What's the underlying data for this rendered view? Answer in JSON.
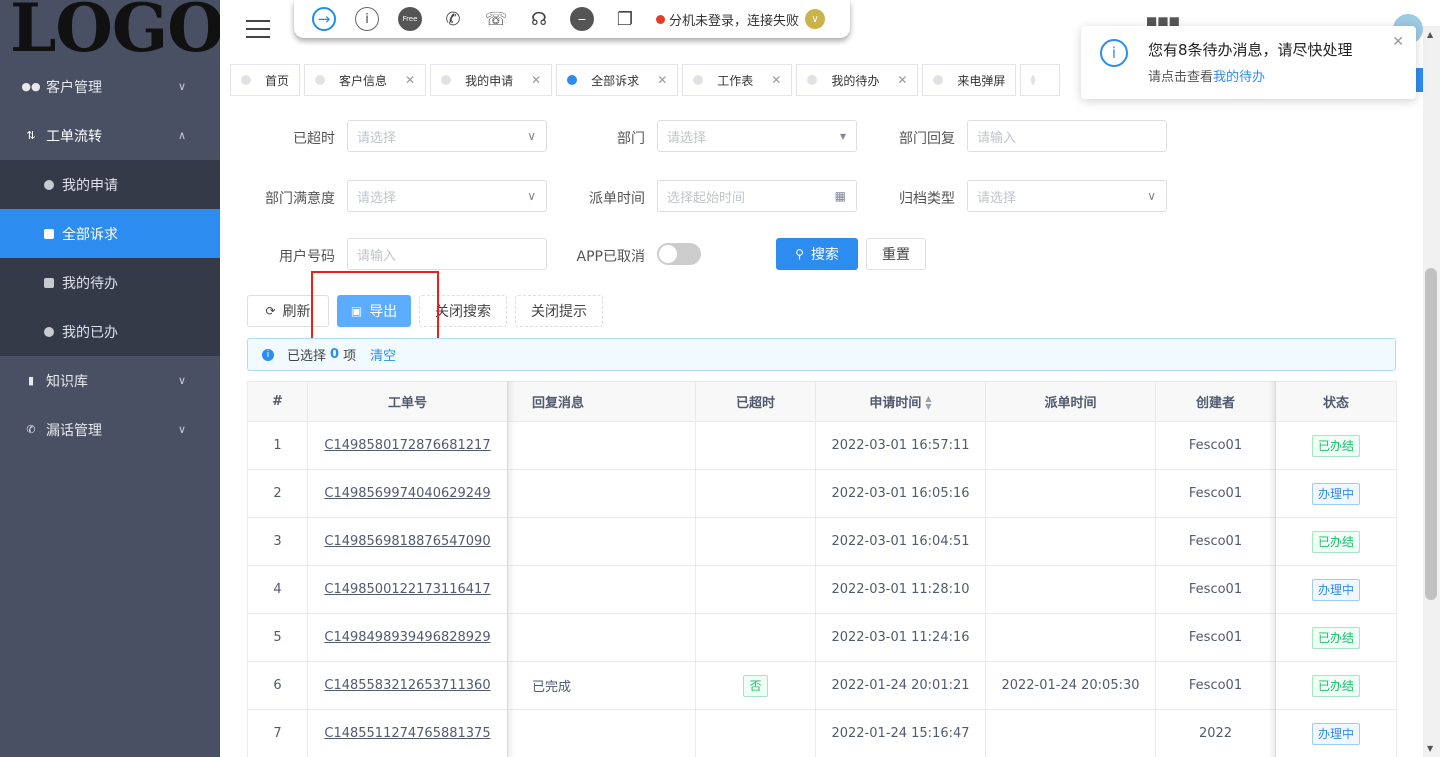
{
  "logo": "LOGO",
  "sidebar": {
    "items": [
      {
        "label": "客户管理",
        "icon": "users-icon",
        "expanded": false
      },
      {
        "label": "工单流转",
        "icon": "workflow-icon",
        "expanded": true
      },
      {
        "label": "知识库",
        "icon": "book-icon",
        "expanded": false
      },
      {
        "label": "漏话管理",
        "icon": "phone-icon",
        "expanded": false
      }
    ],
    "subitems": [
      {
        "label": "我的申请",
        "active": false
      },
      {
        "label": "全部诉求",
        "active": true
      },
      {
        "label": "我的待办",
        "active": false
      },
      {
        "label": "我的已办",
        "active": false
      }
    ]
  },
  "toolbar": {
    "free_label": "Free",
    "status_text": "分机未登录，连接失败",
    "status_color": "#e53b2c"
  },
  "tabs": [
    {
      "label": "首页",
      "closable": false,
      "active": false
    },
    {
      "label": "客户信息",
      "closable": true,
      "active": false
    },
    {
      "label": "我的申请",
      "closable": true,
      "active": false
    },
    {
      "label": "全部诉求",
      "closable": true,
      "active": true
    },
    {
      "label": "工作表",
      "closable": true,
      "active": false
    },
    {
      "label": "我的待办",
      "closable": true,
      "active": false
    },
    {
      "label": "来电弹屏",
      "closable": false,
      "active": false
    }
  ],
  "notification": {
    "title": "您有8条待办消息，请尽快处理",
    "desc_prefix": "请点击查看",
    "desc_link": "我的待办"
  },
  "form": {
    "overdue": {
      "label": "已超时",
      "placeholder": "请选择"
    },
    "dept": {
      "label": "部门",
      "placeholder": "请选择"
    },
    "dept_reply": {
      "label": "部门回复",
      "placeholder": "请输入"
    },
    "dept_satisfaction": {
      "label": "部门满意度",
      "placeholder": "请选择"
    },
    "dispatch_time": {
      "label": "派单时间",
      "placeholder": "选择起始时间"
    },
    "archive_type": {
      "label": "归档类型",
      "placeholder": "请选择"
    },
    "user_phone": {
      "label": "用户号码",
      "placeholder": "请输入"
    },
    "app_cancelled": {
      "label": "APP已取消",
      "on": false
    },
    "search_button": "搜索",
    "reset_button": "重置"
  },
  "actions": {
    "refresh": "刷新",
    "export": "导出",
    "close_search": "关闭搜索",
    "close_tips": "关闭提示"
  },
  "selection": {
    "prefix": "已选择",
    "count": "0",
    "suffix": "项",
    "clear": "清空"
  },
  "table": {
    "headers": [
      "#",
      "工单号",
      "回复消息",
      "已超时",
      "申请时间",
      "派单时间",
      "创建者",
      "状态"
    ],
    "rows": [
      {
        "idx": "1",
        "no": "C1498580172876681217",
        "reply": "",
        "overdue": "",
        "apply": "2022-03-01 16:57:11",
        "dispatch": "",
        "creator": "Fesco01",
        "status": "已办结",
        "status_type": "done"
      },
      {
        "idx": "2",
        "no": "C1498569974040629249",
        "reply": "",
        "overdue": "",
        "apply": "2022-03-01 16:05:16",
        "dispatch": "",
        "creator": "Fesco01",
        "status": "办理中",
        "status_type": "proc"
      },
      {
        "idx": "3",
        "no": "C1498569818876547090",
        "reply": "",
        "overdue": "",
        "apply": "2022-03-01 16:04:51",
        "dispatch": "",
        "creator": "Fesco01",
        "status": "已办结",
        "status_type": "done"
      },
      {
        "idx": "4",
        "no": "C1498500122173116417",
        "reply": "",
        "overdue": "",
        "apply": "2022-03-01 11:28:10",
        "dispatch": "",
        "creator": "Fesco01",
        "status": "办理中",
        "status_type": "proc"
      },
      {
        "idx": "5",
        "no": "C1498498939496828929",
        "reply": "",
        "overdue": "",
        "apply": "2022-03-01 11:24:16",
        "dispatch": "",
        "creator": "Fesco01",
        "status": "已办结",
        "status_type": "done"
      },
      {
        "idx": "6",
        "no": "C1485583212653711360",
        "reply": "已完成",
        "overdue": "否",
        "apply": "2022-01-24 20:01:21",
        "dispatch": "2022-01-24 20:05:30",
        "creator": "Fesco01",
        "status": "已办结",
        "status_type": "done"
      },
      {
        "idx": "7",
        "no": "C1485511274765881375",
        "reply": "",
        "overdue": "",
        "apply": "2022-01-24 15:16:47",
        "dispatch": "",
        "creator": "2022",
        "status": "办理中",
        "status_type": "proc"
      }
    ]
  }
}
